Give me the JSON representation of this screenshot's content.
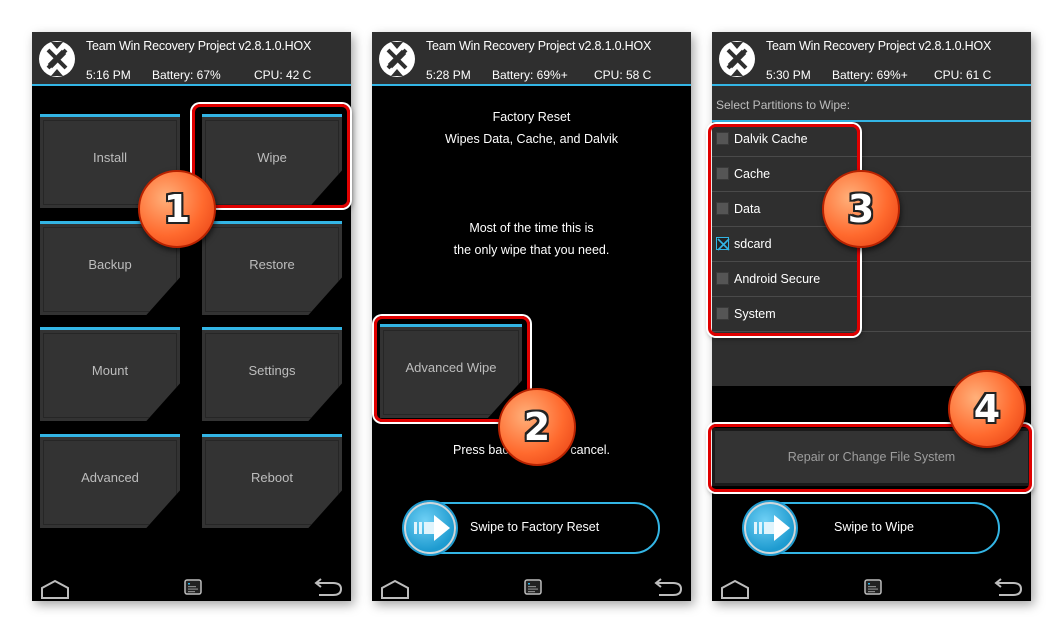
{
  "header": {
    "app_title": "Team Win Recovery Project  v2.8.1.0.HOX"
  },
  "screens": [
    {
      "status": {
        "time": "5:16 PM",
        "battery": "Battery: 67%",
        "cpu": "CPU: 42 C"
      },
      "tiles": [
        "Install",
        "Wipe",
        "Backup",
        "Restore",
        "Mount",
        "Settings",
        "Advanced",
        "Reboot"
      ]
    },
    {
      "status": {
        "time": "5:28 PM",
        "battery": "Battery: 69%+",
        "cpu": "CPU: 58 C"
      },
      "title_line1": "Factory Reset",
      "title_line2": "Wipes Data, Cache, and Dalvik",
      "note_line1": "Most of the time this is",
      "note_line2": "the only wipe that you need.",
      "advanced_wipe_label": "Advanced Wipe",
      "cancel_hint": "Press back button to cancel.",
      "swipe_label": "Swipe to Factory Reset"
    },
    {
      "status": {
        "time": "5:30 PM",
        "battery": "Battery: 69%+",
        "cpu": "CPU: 61 C"
      },
      "list_title": "Select Partitions to Wipe:",
      "partitions": [
        {
          "label": "Dalvik Cache",
          "checked": false
        },
        {
          "label": "Cache",
          "checked": false
        },
        {
          "label": "Data",
          "checked": false
        },
        {
          "label": "sdcard",
          "checked": true
        },
        {
          "label": "Android Secure",
          "checked": false
        },
        {
          "label": "System",
          "checked": false
        }
      ],
      "repair_label": "Repair or Change File System",
      "swipe_label": "Swipe to Wipe"
    }
  ],
  "nav": {
    "home_icon": "home-icon",
    "log_icon": "console-log-icon",
    "back_icon": "back-icon"
  },
  "annotations": [
    "1",
    "2",
    "3",
    "4"
  ],
  "colors": {
    "accent": "#33b5e5",
    "highlight": "#e00000",
    "badge": "#ff6a2e",
    "tile": "#333333",
    "header": "#2f2f2f"
  }
}
